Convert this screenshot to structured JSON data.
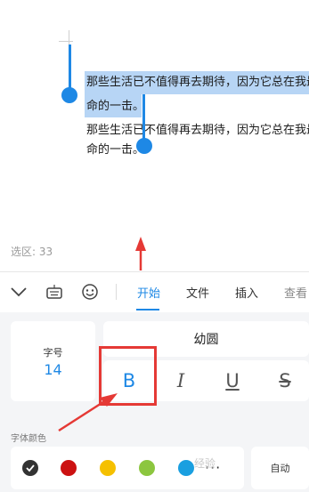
{
  "document": {
    "selected_lines": [
      "那些生活已不值得再去期待，因为它总在我最",
      "命的一击。"
    ],
    "lines": [
      "那些生活已不值得再去期待，因为它总在我最",
      "命的一击。"
    ]
  },
  "selection_count": "选区: 33",
  "toolbar": {
    "tabs": [
      {
        "label": "开始",
        "active": true
      },
      {
        "label": "文件",
        "active": false
      },
      {
        "label": "插入",
        "active": false
      },
      {
        "label": "查看",
        "active": false
      }
    ]
  },
  "format": {
    "font_size_label": "字号",
    "font_size_value": "14",
    "font_name": "幼圆",
    "styles": {
      "bold": "B",
      "italic": "I",
      "underline": "U",
      "strike": "S"
    },
    "bold_active": true,
    "font_color_label": "字体颜色",
    "colors": [
      "#333333",
      "#cc1111",
      "#f5c000",
      "#8cc63f",
      "#1a9fe0"
    ],
    "more": "···",
    "auto_label": "自动"
  },
  "watermark": "经验",
  "accent_color": "#1e88e5",
  "annotation_color": "#e53935"
}
